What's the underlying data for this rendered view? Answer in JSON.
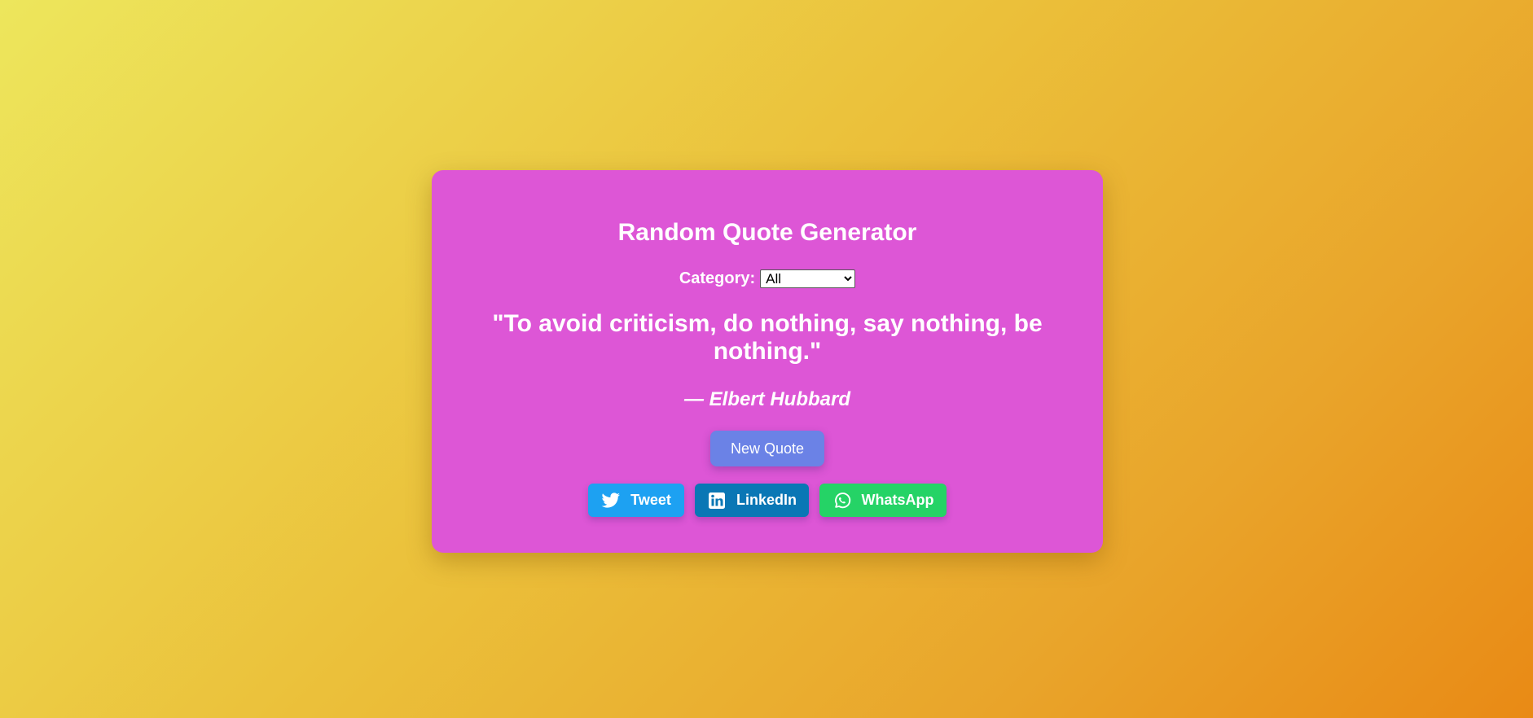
{
  "app": {
    "title": "Random Quote Generator"
  },
  "category": {
    "label": "Category:",
    "selected": "All",
    "options": [
      "All"
    ]
  },
  "quote": {
    "text": "\"To avoid criticism, do nothing, say nothing, be nothing.\"",
    "dash": "—",
    "author": "Elbert Hubbard"
  },
  "actions": {
    "new_quote_label": "New Quote"
  },
  "share": {
    "tweet_label": "Tweet",
    "linkedin_label": "LinkedIn",
    "whatsapp_label": "WhatsApp",
    "tweet_icon": "twitter-bird-icon",
    "linkedin_icon": "linkedin-icon",
    "whatsapp_icon": "whatsapp-icon"
  },
  "colors": {
    "card": "#dd56d6",
    "new_quote": "#6b82e6",
    "twitter": "#1da1f2",
    "linkedin": "#0a77b5",
    "whatsapp": "#25d366"
  }
}
